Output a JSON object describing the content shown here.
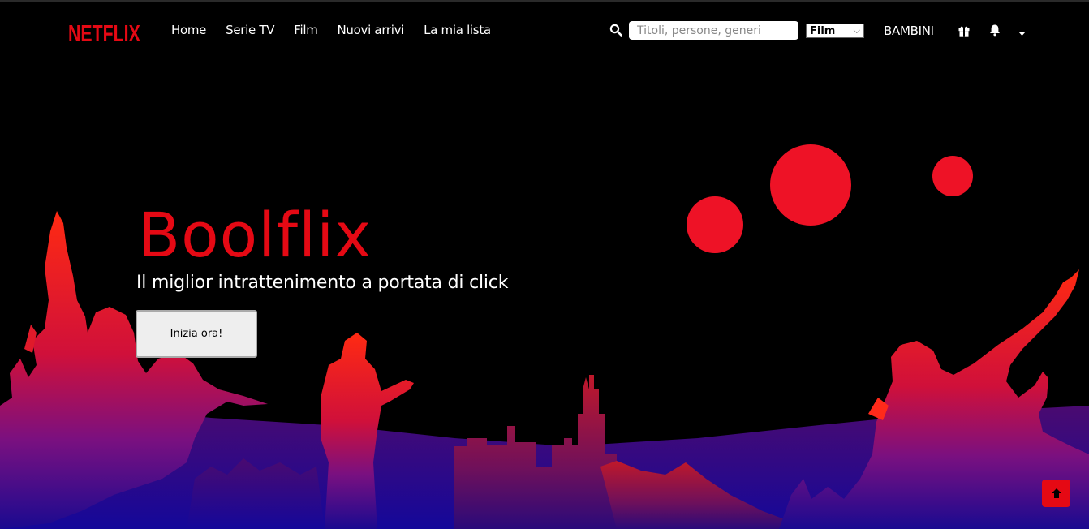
{
  "header": {
    "logo": "NETFLIX",
    "nav": [
      "Home",
      "Serie TV",
      "Film",
      "Nuovi arrivi",
      "La mia lista"
    ],
    "search": {
      "placeholder": "Titoli, persone, generi",
      "value": ""
    },
    "type_select": {
      "selected": "Film"
    },
    "kids_label": "BAMBINI",
    "icons": [
      "search-icon",
      "gift-icon",
      "bell-icon",
      "caret-down-icon"
    ]
  },
  "hero": {
    "title": "Boolflix",
    "subtitle": "Il miglior intrattenimento a portata di click",
    "cta_label": "Inizia ora!"
  },
  "scroll_top": {
    "icon": "arrow-up-icon"
  },
  "colors": {
    "brand": "#e50914",
    "background": "#000000",
    "crowd_top": "#ff1a1a",
    "crowd_mid": "#b0105a",
    "crowd_bottom": "#1a0a8a"
  }
}
